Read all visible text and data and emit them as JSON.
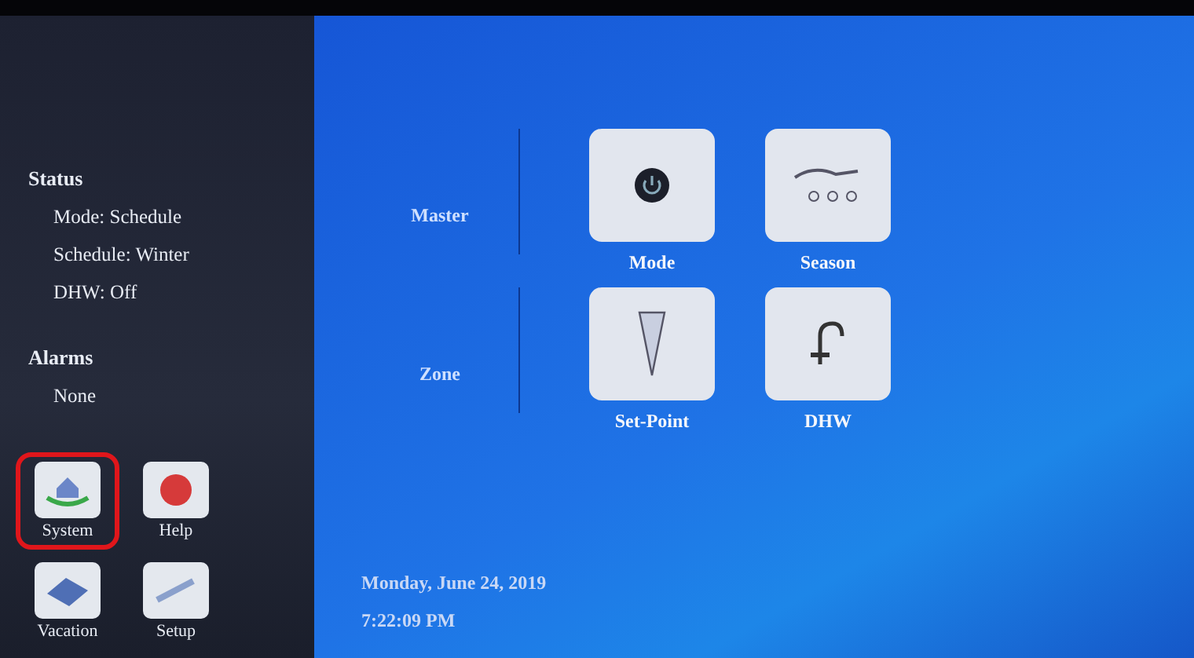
{
  "sidebar": {
    "status": {
      "heading": "Status",
      "items": [
        "Mode: Schedule",
        "Schedule: Winter",
        "DHW: Off"
      ]
    },
    "alarms": {
      "heading": "Alarms",
      "items": [
        "None"
      ]
    },
    "buttons": [
      {
        "label": "System",
        "kind": "system",
        "highlighted": true
      },
      {
        "label": "Help",
        "kind": "help",
        "highlighted": false
      },
      {
        "label": "Vacation",
        "kind": "vacation",
        "highlighted": false
      },
      {
        "label": "Setup",
        "kind": "setup",
        "highlighted": false
      }
    ]
  },
  "groups": [
    {
      "label": "Master",
      "buttons": [
        {
          "label": "Mode",
          "kind": "mode"
        },
        {
          "label": "Season",
          "kind": "season"
        }
      ]
    },
    {
      "label": "Zone",
      "buttons": [
        {
          "label": "Set-Point",
          "kind": "setpoint"
        },
        {
          "label": "DHW",
          "kind": "faucet"
        }
      ]
    }
  ],
  "footer": {
    "date": "Monday, June 24, 2019",
    "time": "7:22:09 PM"
  }
}
